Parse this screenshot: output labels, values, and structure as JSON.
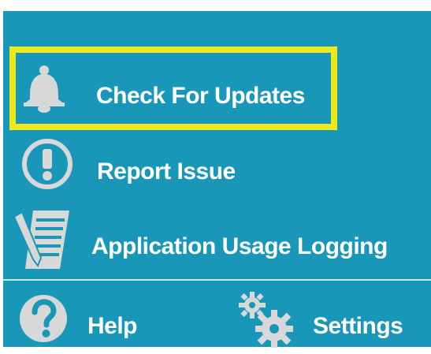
{
  "menu": {
    "check_updates": {
      "label": "Check For Updates",
      "icon": "bell-icon",
      "highlighted": true
    },
    "report_issue": {
      "label": "Report Issue",
      "icon": "exclamation-circle-icon"
    },
    "usage_logging": {
      "label": "Application Usage Logging",
      "icon": "notepad-pencil-icon"
    }
  },
  "footer": {
    "help": {
      "label": "Help",
      "icon": "question-circle-icon"
    },
    "settings": {
      "label": "Settings",
      "icon": "gears-icon"
    }
  },
  "colors": {
    "background": "#1897b9",
    "text": "#ffffff",
    "icon": "#d8d8d8",
    "highlight": "#f0e91d"
  }
}
